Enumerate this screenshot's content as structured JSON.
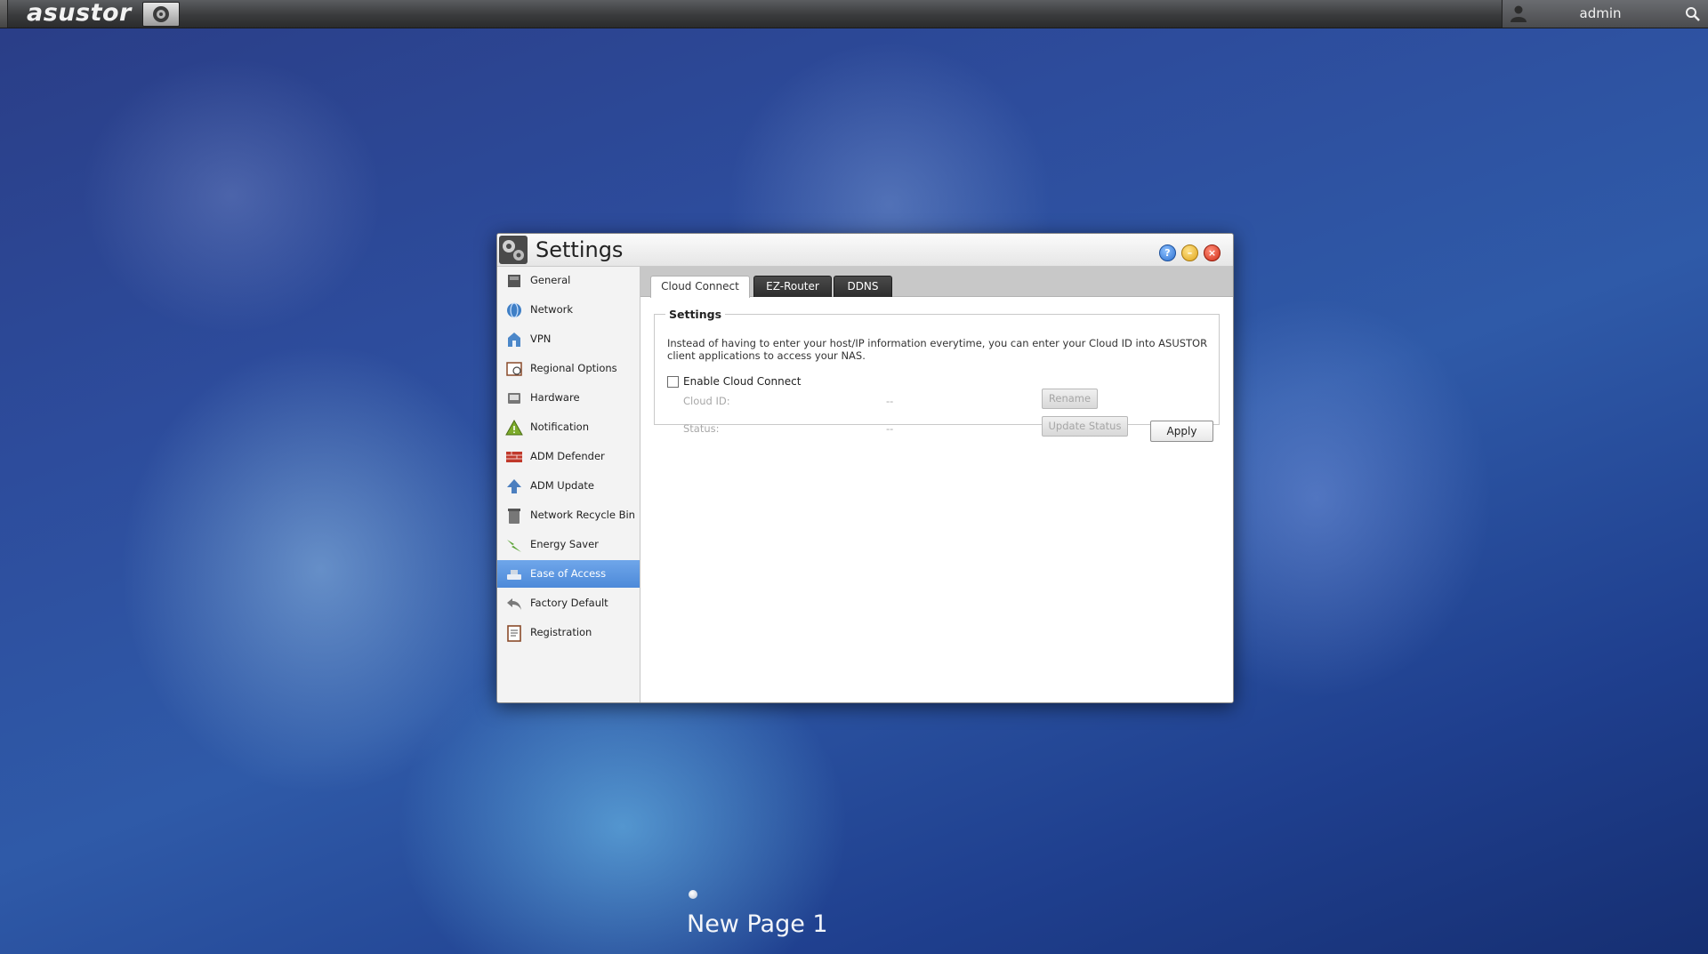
{
  "topbar": {
    "brand": "asustor",
    "user": "admin"
  },
  "window": {
    "title": "Settings"
  },
  "sidebar": {
    "items": [
      {
        "label": "General",
        "icon": "general-icon"
      },
      {
        "label": "Network",
        "icon": "network-icon"
      },
      {
        "label": "VPN",
        "icon": "vpn-icon"
      },
      {
        "label": "Regional Options",
        "icon": "regional-options-icon"
      },
      {
        "label": "Hardware",
        "icon": "hardware-icon"
      },
      {
        "label": "Notification",
        "icon": "notification-icon"
      },
      {
        "label": "ADM Defender",
        "icon": "adm-defender-icon"
      },
      {
        "label": "ADM Update",
        "icon": "adm-update-icon"
      },
      {
        "label": "Network Recycle Bin",
        "icon": "recycle-bin-icon"
      },
      {
        "label": "Energy Saver",
        "icon": "energy-saver-icon"
      },
      {
        "label": "Ease of Access",
        "icon": "ease-of-access-icon"
      },
      {
        "label": "Factory Default",
        "icon": "factory-default-icon"
      },
      {
        "label": "Registration",
        "icon": "registration-icon"
      }
    ],
    "active": "Ease of Access"
  },
  "tabs": [
    {
      "label": "Cloud Connect",
      "active": true
    },
    {
      "label": "EZ-Router",
      "active": false
    },
    {
      "label": "DDNS",
      "active": false
    }
  ],
  "settings": {
    "legend": "Settings",
    "description": "Instead of having to enter your host/IP information everytime, you can enter your Cloud ID into ASUSTOR client applications to access your NAS.",
    "enable_label": "Enable Cloud Connect",
    "enabled": false,
    "cloud_id_label": "Cloud ID:",
    "cloud_id_value": "--",
    "status_label": "Status:",
    "status_value": "--",
    "rename_label": "Rename",
    "update_status_label": "Update Status",
    "apply_label": "Apply"
  },
  "desktop": {
    "page_name": "New Page 1"
  },
  "colors": {
    "active_item": "#5a95e0",
    "tab_dark": "#333333",
    "close": "#d22d16",
    "minimize": "#e0a419",
    "help": "#2b6fcf"
  }
}
